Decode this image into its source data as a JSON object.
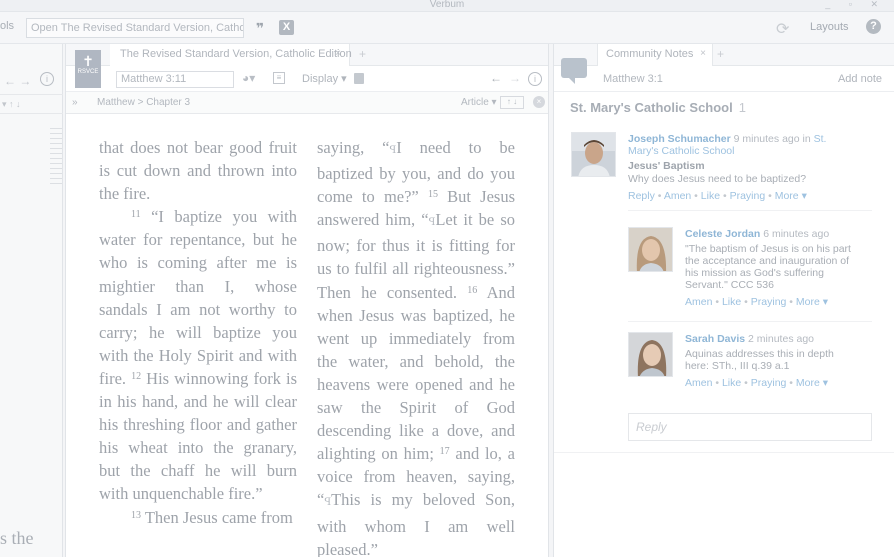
{
  "app": {
    "title": "Verbum",
    "window_controls": "_ ▫ ✕"
  },
  "toolbar": {
    "tools_label": "ols",
    "command_text": "Open The Revised Standard Version, Catholi...",
    "quote_icon": "quote-icon",
    "layouts_label": "Layouts",
    "help_label": "?"
  },
  "left_pane": {
    "nav_arrows": "← →",
    "info": "i",
    "sub_controls": "▾ ↑ ↓",
    "tail_text": "s the"
  },
  "center_pane": {
    "tab_title": "The Revised Standard Version, Catholic Edition",
    "tab_close": "×",
    "tab_add": "+",
    "book_badge": "RSVCE",
    "reference": "Matthew 3:11",
    "display_label": "Display ▾",
    "info": "i",
    "breadcrumb": {
      "toggle": "»",
      "path": "Matthew  >  Chapter 3",
      "article": "Article ▾",
      "updown": "↑ ↓",
      "close": "×"
    }
  },
  "text": {
    "c1_l1": "that does not bear good fruit is cut down and thrown into the fire.",
    "v11": "11",
    "c1_p2": "“I baptize you with water for repentance, but he who is coming after me is mightier than I, whose sandals I am not worthy to carry; he will baptize you with the Holy Spirit and with fire.",
    "v12": "12",
    "c1_p2b": "His winnowing fork is in his hand, and he will clear his threshing floor and gather his wheat into the granary, but the chaff he will burn with unquenchable fire.”",
    "v13": "13",
    "c1_p3": "Then Jesus came from",
    "c2_a": "saying, “",
    "c2_b": "I need to be baptized by you, and do you come to me?”",
    "v15": "15",
    "c2_c": "But Jesus answered him, “",
    "c2_d": "Let it be so now; for thus it is fitting for us to fulfil all righteousness.” Then he consented.",
    "v16": "16",
    "c2_e": "And when Jesus was baptized, he went up immediately from the water, and behold, the heavens were opened and he saw the Spirit of God descending like a dove, and alighting on him;",
    "v17": "17",
    "c2_f": "and lo, a voice from heaven, saying, “",
    "c2_g": "This is my beloved Son, with whom I am well pleased.”",
    "speech_icon": "ꟼ"
  },
  "right_pane": {
    "tab_title": "Community Notes",
    "tab_close": "×",
    "tab_add": "+",
    "reference": "Matthew 3:1",
    "add_note": "Add note",
    "group_name": "St. Mary's Catholic School",
    "group_count": "1",
    "notes": [
      {
        "author": "Joseph Schumacher",
        "time": "9 minutes ago",
        "in": "in",
        "group": "St. Mary's Catholic School",
        "title": "Jesus' Baptism",
        "body": "Why does Jesus need to be baptized?",
        "actions": [
          "Reply",
          "Amen",
          "Like",
          "Praying",
          "More"
        ]
      },
      {
        "author": "Celeste Jordan",
        "time": "6 minutes ago",
        "body": "\"The baptism of Jesus is on his part the acceptance and inauguration of his mission as God's suffering Servant.\" CCC 536",
        "actions": [
          "Amen",
          "Like",
          "Praying",
          "More"
        ]
      },
      {
        "author": "Sarah Davis",
        "time": "2 minutes ago",
        "body": "Aquinas addresses this in depth here: STh., III q.39 a.1",
        "actions": [
          "Amen",
          "Like",
          "Praying",
          "More"
        ]
      }
    ],
    "reply_placeholder": "Reply",
    "more_arrow": "▾",
    "bullet": "•"
  },
  "colors": {
    "link": "#9ec2e0",
    "text": "#9ea3aa",
    "background": "#ffffff"
  }
}
